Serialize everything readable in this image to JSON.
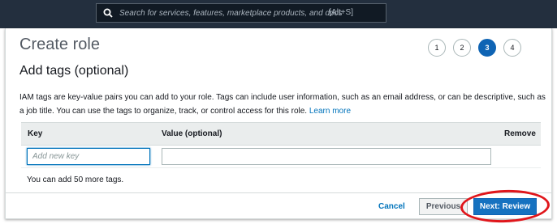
{
  "topbar": {
    "search_placeholder": "Search for services, features, marketplace products, and docs",
    "search_shortcut": "[Alt+S]"
  },
  "page": {
    "title": "Create role",
    "steps": [
      "1",
      "2",
      "3",
      "4"
    ],
    "active_step": "3"
  },
  "tags": {
    "heading": "Add tags (optional)",
    "description": "IAM tags are key-value pairs you can add to your role. Tags can include user information, such as an email address, or can be descriptive, such as a job title. You can use the tags to organize, track, or control access for this role.",
    "learn_more": "Learn more",
    "columns": {
      "key": "Key",
      "value": "Value (optional)",
      "remove": "Remove"
    },
    "key_placeholder": "Add new key",
    "value_placeholder": "",
    "remaining_note": "You can add 50 more tags."
  },
  "footer": {
    "cancel_label": "Cancel",
    "previous_label": "Previous",
    "next_label": "Next: Review"
  },
  "colors": {
    "topbar": "#232f3e",
    "primary_button": "#1672c0",
    "link": "#0073bb",
    "annotation": "#e0161b"
  }
}
